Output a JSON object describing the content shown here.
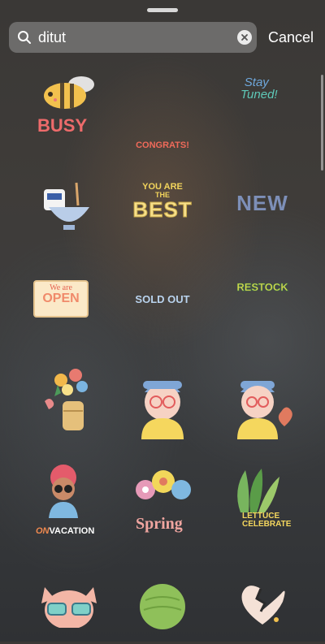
{
  "search": {
    "value": "ditut"
  },
  "cancel_label": "Cancel",
  "stickers": {
    "busy": "BUSY",
    "congrats": "CONGRATS!",
    "stay_tuned_1": "Stay",
    "stay_tuned_2": "Tuned!",
    "you_are": "YOU ARE",
    "the": "THE",
    "best": "BEST",
    "new": "NEW",
    "we_are": "We are",
    "open": "OPEN",
    "sold_out": "SOLD OUT",
    "restock": "RESTOCK",
    "on": "ON",
    "vacation": "VACATION",
    "spring": "Spring",
    "lettuce": "LETTUCE",
    "celebrate": "CELEBRATE"
  },
  "colors": {
    "busy": "#ee6b6b",
    "congrats": "#f06a5a",
    "new": "#7d8fb8",
    "sold_out": "#b9d3ee",
    "restock": "#e6d84a"
  }
}
